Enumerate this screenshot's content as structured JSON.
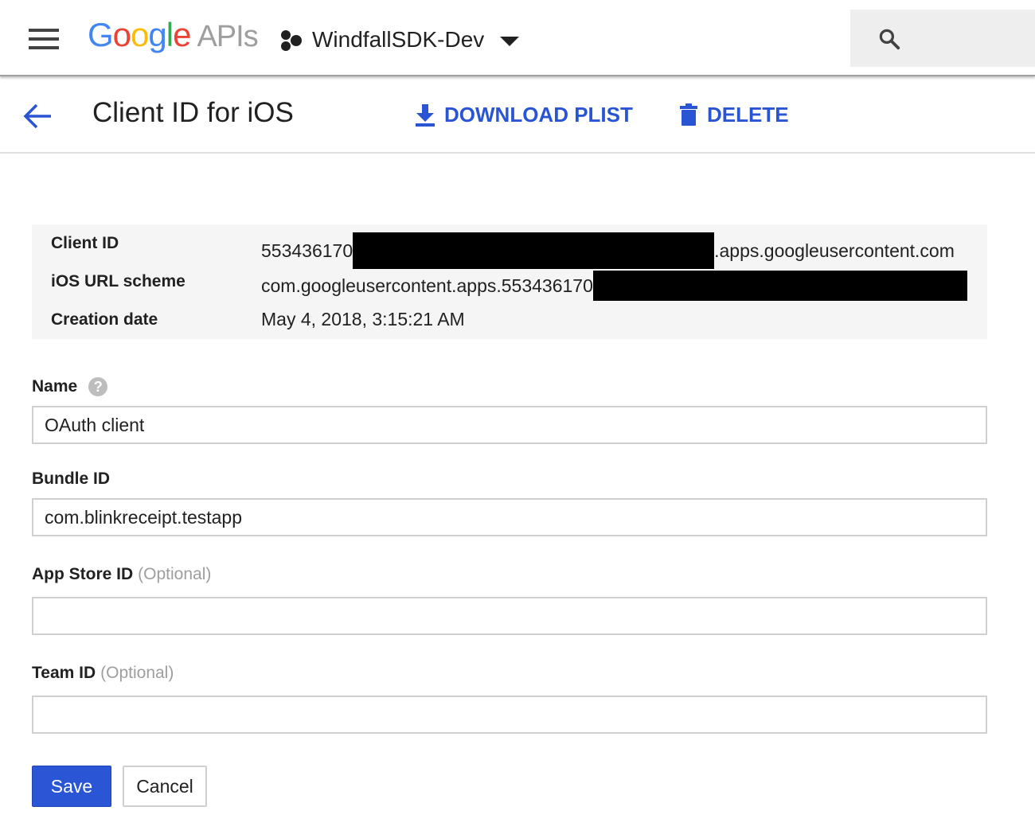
{
  "topbar": {
    "logo_letters": [
      {
        "char": "G",
        "color": "#4285F4"
      },
      {
        "char": "o",
        "color": "#EA4335"
      },
      {
        "char": "o",
        "color": "#FBBC05"
      },
      {
        "char": "g",
        "color": "#4285F4"
      },
      {
        "char": "l",
        "color": "#34A853"
      },
      {
        "char": "e",
        "color": "#EA4335"
      }
    ],
    "logo_suffix": "APIs",
    "project_name": "WindfallSDK-Dev",
    "icons": {
      "menu": "hamburger-menu-icon",
      "project": "project-hexagon-icon",
      "dropdown": "caret-down-icon",
      "search": "search-icon"
    }
  },
  "header": {
    "title": "Client ID for iOS",
    "download_label": "DOWNLOAD PLIST",
    "delete_label": "DELETE",
    "accent_color": "#2954d4"
  },
  "info": {
    "rows": [
      {
        "label": "Client ID",
        "value_prefix": "553436170",
        "value_suffix": ".apps.googleusercontent.com"
      },
      {
        "label": "iOS URL scheme",
        "value_prefix": "com.googleusercontent.apps.553436170",
        "value_suffix": ""
      },
      {
        "label": "Creation date",
        "value_prefix": "May 4, 2018, 3:15:21 AM",
        "value_suffix": ""
      }
    ]
  },
  "form": {
    "name_label": "Name",
    "name_value": "OAuth client",
    "bundle_label": "Bundle ID",
    "bundle_value": "com.blinkreceipt.testapp",
    "appstore_label": "App Store ID",
    "appstore_optional": "(Optional)",
    "appstore_value": "",
    "team_label": "Team ID",
    "team_optional": "(Optional)",
    "team_value": "",
    "help_glyph": "?"
  },
  "actions": {
    "save_label": "Save",
    "cancel_label": "Cancel",
    "save_color": "#2a56d6"
  }
}
